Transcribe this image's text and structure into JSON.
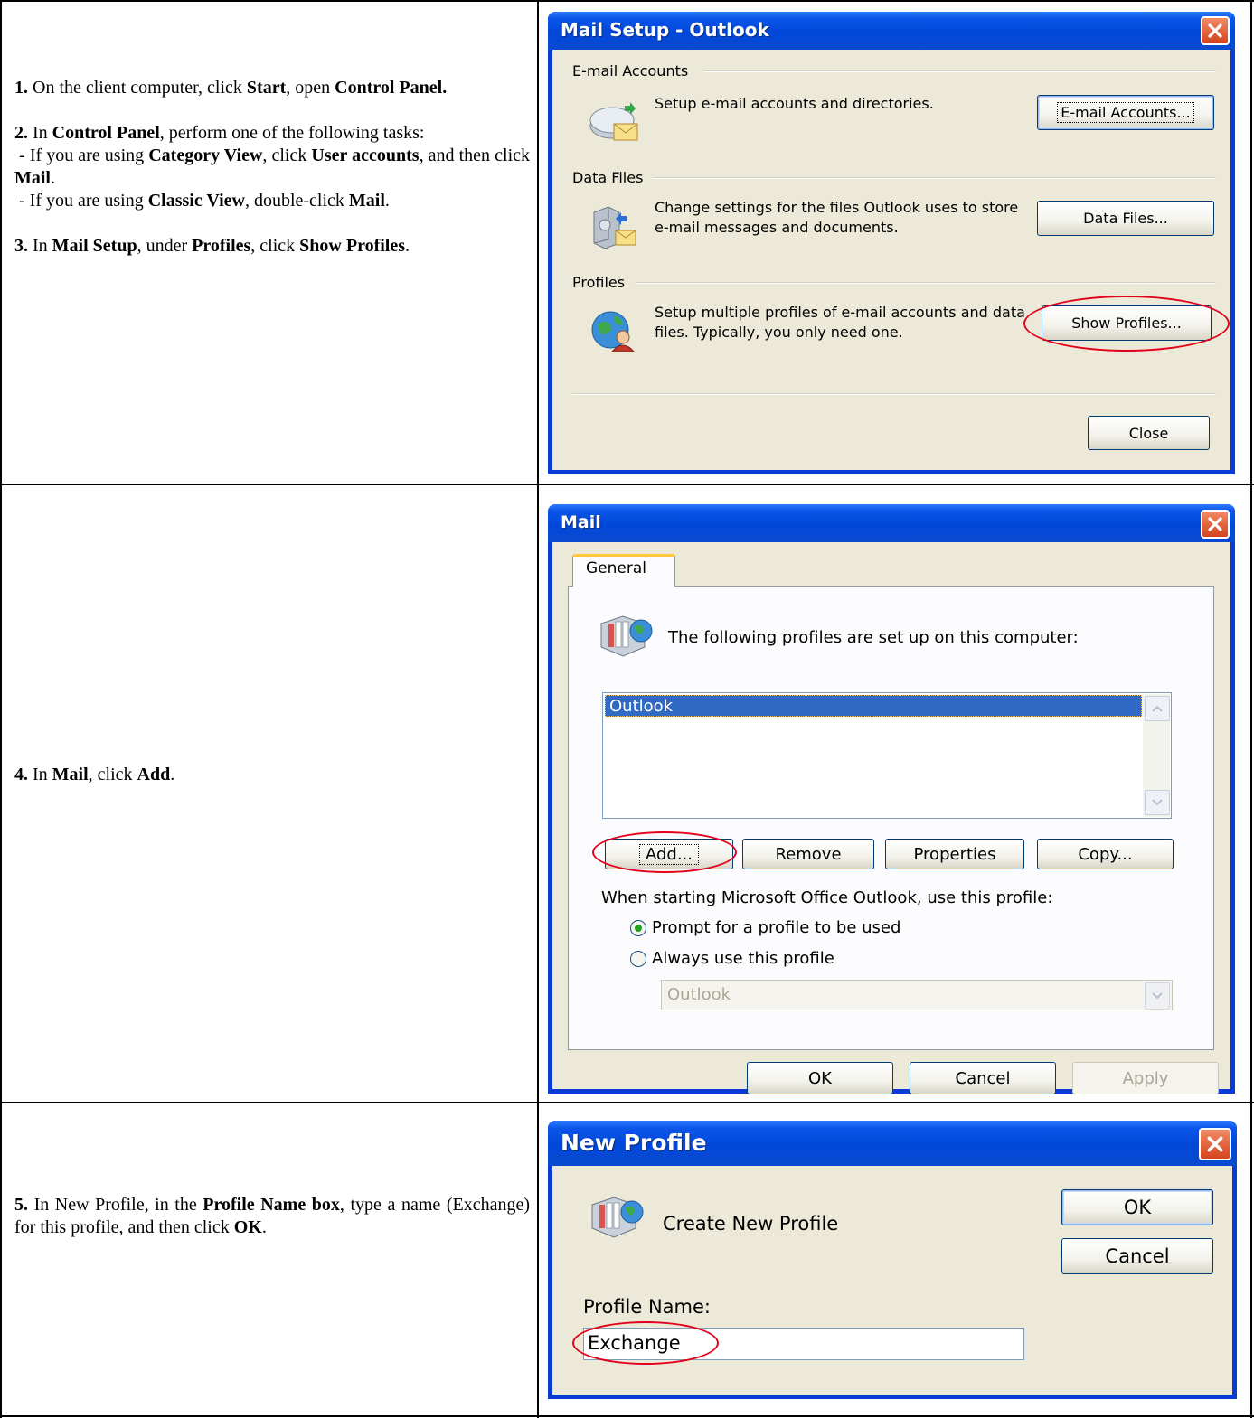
{
  "row1": {
    "steps": [
      {
        "num": "1.",
        "html": "On the client computer, click <b>Start</b>, open <b>Control Panel.</b>"
      },
      {
        "num": "2.",
        "html": "In <b>Control Panel</b>, perform one of the following tasks:<br>&nbsp;- If you are using <b>Category View</b>, click <b>User accounts</b>, and then click <b>Mail</b>.<br>&nbsp;- If you are using <b>Classic View</b>, double-click <b>Mail</b>."
      },
      {
        "num": "3.",
        "html": "In <b>Mail Setup</b>, under <b>Profiles</b>, click <b>Show Profiles</b>."
      }
    ],
    "dialog": {
      "title": "Mail Setup - Outlook",
      "email_group": "E-mail Accounts",
      "email_text": "Setup e-mail accounts and directories.",
      "email_button": "E-mail Accounts...",
      "data_group": "Data Files",
      "data_text": "Change settings for the files Outlook uses to store e-mail messages and documents.",
      "data_button": "Data Files...",
      "profiles_group": "Profiles",
      "profiles_text": "Setup multiple profiles of e-mail accounts and data files. Typically, you only need one.",
      "profiles_button": "Show Profiles...",
      "close_button": "Close"
    }
  },
  "row2": {
    "step": {
      "num": "4.",
      "html": "In <b>Mail</b>, click <b>Add</b>."
    },
    "dialog": {
      "title": "Mail",
      "tab": "General",
      "profiles_caption": "The following profiles are set up on this computer:",
      "profiles_list": [
        "Outlook"
      ],
      "add_button": "Add...",
      "remove_button": "Remove",
      "properties_button": "Properties",
      "copy_button": "Copy...",
      "startup_caption": "When starting Microsoft Office Outlook, use this profile:",
      "radio_prompt": "Prompt for a profile to be used",
      "radio_always": "Always use this profile",
      "radio_selected": "prompt",
      "profile_select": "Outlook",
      "ok_button": "OK",
      "cancel_button": "Cancel",
      "apply_button": "Apply"
    }
  },
  "row3": {
    "step": {
      "num": "5.",
      "html": "In New Profile, in the <b>Profile Name box</b>, type a name (Exchange) for this profile, and then click <b>OK</b>."
    },
    "dialog": {
      "title": "New Profile",
      "caption": "Create New Profile",
      "name_label": "Profile Name:",
      "name_value": "Exchange",
      "ok_button": "OK",
      "cancel_button": "Cancel"
    }
  }
}
